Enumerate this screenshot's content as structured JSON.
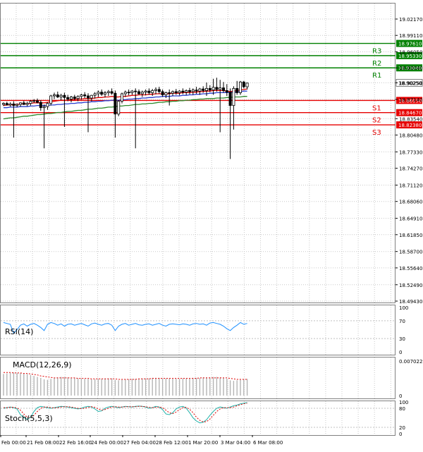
{
  "chart_data": {
    "type": "candlestick",
    "price_axis": {
      "ticks": [
        "19.02170",
        "18.99110",
        "18.96050",
        "18.93040",
        "18.90250",
        "18.87140",
        "18.83540",
        "18.80480",
        "18.77330",
        "18.74270",
        "18.71120",
        "18.68060",
        "18.64910",
        "18.61850",
        "18.58700",
        "18.55640",
        "18.52490",
        "18.49430"
      ],
      "ylim": [
        18.4943,
        19.0217
      ]
    },
    "time_axis": {
      "labels": [
        "Feb 00:00",
        "21 Feb 08:00",
        "22 Feb 16:00",
        "24 Feb 00:00",
        "27 Feb 04:00",
        "28 Feb 12:00",
        "1 Mar 20:00",
        "3 Mar 04:00",
        "6 Mar 08:00"
      ]
    },
    "levels": [
      {
        "name": "R3",
        "value": "18.97610",
        "color": "#008000"
      },
      {
        "name": "R2",
        "value": "18.95330",
        "color": "#008000"
      },
      {
        "name": "R1",
        "value": "18.93040",
        "color": "#008000"
      },
      {
        "name": "S1",
        "value": "18.86950",
        "color": "#e60000"
      },
      {
        "name": "S2",
        "value": "18.84670",
        "color": "#e60000"
      },
      {
        "name": "S3",
        "value": "18.82380",
        "color": "#e60000"
      }
    ],
    "current_price": "18.90250",
    "candles": [
      {
        "o": 18.862,
        "h": 18.866,
        "l": 18.859,
        "c": 18.864
      },
      {
        "o": 18.864,
        "h": 18.867,
        "l": 18.86,
        "c": 18.861
      },
      {
        "o": 18.861,
        "h": 18.866,
        "l": 18.858,
        "c": 18.863
      },
      {
        "o": 18.863,
        "h": 18.868,
        "l": 18.8,
        "c": 18.86
      },
      {
        "o": 18.86,
        "h": 18.864,
        "l": 18.857,
        "c": 18.862
      },
      {
        "o": 18.862,
        "h": 18.866,
        "l": 18.858,
        "c": 18.865
      },
      {
        "o": 18.865,
        "h": 18.869,
        "l": 18.861,
        "c": 18.862
      },
      {
        "o": 18.862,
        "h": 18.867,
        "l": 18.859,
        "c": 18.864
      },
      {
        "o": 18.864,
        "h": 18.87,
        "l": 18.86,
        "c": 18.868
      },
      {
        "o": 18.868,
        "h": 18.872,
        "l": 18.865,
        "c": 18.869
      },
      {
        "o": 18.869,
        "h": 18.873,
        "l": 18.864,
        "c": 18.866
      },
      {
        "o": 18.866,
        "h": 18.87,
        "l": 18.85,
        "c": 18.856
      },
      {
        "o": 18.856,
        "h": 18.862,
        "l": 18.78,
        "c": 18.858
      },
      {
        "o": 18.858,
        "h": 18.866,
        "l": 18.852,
        "c": 18.864
      },
      {
        "o": 18.864,
        "h": 18.88,
        "l": 18.86,
        "c": 18.878
      },
      {
        "o": 18.878,
        "h": 18.884,
        "l": 18.872,
        "c": 18.88
      },
      {
        "o": 18.88,
        "h": 18.886,
        "l": 18.874,
        "c": 18.876
      },
      {
        "o": 18.876,
        "h": 18.882,
        "l": 18.87,
        "c": 18.879
      },
      {
        "o": 18.879,
        "h": 18.884,
        "l": 18.82,
        "c": 18.875
      },
      {
        "o": 18.875,
        "h": 18.88,
        "l": 18.868,
        "c": 18.872
      },
      {
        "o": 18.872,
        "h": 18.878,
        "l": 18.866,
        "c": 18.876
      },
      {
        "o": 18.876,
        "h": 18.88,
        "l": 18.87,
        "c": 18.873
      },
      {
        "o": 18.873,
        "h": 18.879,
        "l": 18.868,
        "c": 18.877
      },
      {
        "o": 18.877,
        "h": 18.882,
        "l": 18.871,
        "c": 18.88
      },
      {
        "o": 18.88,
        "h": 18.885,
        "l": 18.874,
        "c": 18.878
      },
      {
        "o": 18.878,
        "h": 18.883,
        "l": 18.81,
        "c": 18.874
      },
      {
        "o": 18.874,
        "h": 18.88,
        "l": 18.868,
        "c": 18.879
      },
      {
        "o": 18.879,
        "h": 18.885,
        "l": 18.873,
        "c": 18.882
      },
      {
        "o": 18.882,
        "h": 18.888,
        "l": 18.876,
        "c": 18.885
      },
      {
        "o": 18.885,
        "h": 18.89,
        "l": 18.878,
        "c": 18.881
      },
      {
        "o": 18.881,
        "h": 18.887,
        "l": 18.875,
        "c": 18.884
      },
      {
        "o": 18.884,
        "h": 18.889,
        "l": 18.878,
        "c": 18.886
      },
      {
        "o": 18.886,
        "h": 18.892,
        "l": 18.88,
        "c": 18.883
      },
      {
        "o": 18.883,
        "h": 18.888,
        "l": 18.8,
        "c": 18.844
      },
      {
        "o": 18.844,
        "h": 18.87,
        "l": 18.84,
        "c": 18.868
      },
      {
        "o": 18.868,
        "h": 18.884,
        "l": 18.864,
        "c": 18.882
      },
      {
        "o": 18.882,
        "h": 18.888,
        "l": 18.876,
        "c": 18.885
      },
      {
        "o": 18.885,
        "h": 18.89,
        "l": 18.879,
        "c": 18.884
      },
      {
        "o": 18.884,
        "h": 18.889,
        "l": 18.88,
        "c": 18.887
      },
      {
        "o": 18.887,
        "h": 18.892,
        "l": 18.78,
        "c": 18.886
      },
      {
        "o": 18.886,
        "h": 18.89,
        "l": 18.88,
        "c": 18.882
      },
      {
        "o": 18.882,
        "h": 18.888,
        "l": 18.876,
        "c": 18.885
      },
      {
        "o": 18.885,
        "h": 18.89,
        "l": 18.879,
        "c": 18.887
      },
      {
        "o": 18.887,
        "h": 18.892,
        "l": 18.88,
        "c": 18.884
      },
      {
        "o": 18.884,
        "h": 18.891,
        "l": 18.878,
        "c": 18.888
      },
      {
        "o": 18.888,
        "h": 18.894,
        "l": 18.881,
        "c": 18.89
      },
      {
        "o": 18.89,
        "h": 18.895,
        "l": 18.882,
        "c": 18.886
      },
      {
        "o": 18.886,
        "h": 18.89,
        "l": 18.876,
        "c": 18.88
      },
      {
        "o": 18.88,
        "h": 18.886,
        "l": 18.874,
        "c": 18.884
      },
      {
        "o": 18.884,
        "h": 18.89,
        "l": 18.86,
        "c": 18.883
      },
      {
        "o": 18.883,
        "h": 18.888,
        "l": 18.878,
        "c": 18.886
      },
      {
        "o": 18.886,
        "h": 18.891,
        "l": 18.88,
        "c": 18.884
      },
      {
        "o": 18.884,
        "h": 18.889,
        "l": 18.879,
        "c": 18.887
      },
      {
        "o": 18.887,
        "h": 18.892,
        "l": 18.881,
        "c": 18.885
      },
      {
        "o": 18.885,
        "h": 18.89,
        "l": 18.88,
        "c": 18.888
      },
      {
        "o": 18.888,
        "h": 18.893,
        "l": 18.881,
        "c": 18.886
      },
      {
        "o": 18.886,
        "h": 18.892,
        "l": 18.88,
        "c": 18.889
      },
      {
        "o": 18.889,
        "h": 18.895,
        "l": 18.882,
        "c": 18.887
      },
      {
        "o": 18.887,
        "h": 18.893,
        "l": 18.88,
        "c": 18.891
      },
      {
        "o": 18.891,
        "h": 18.896,
        "l": 18.884,
        "c": 18.888
      },
      {
        "o": 18.888,
        "h": 18.903,
        "l": 18.878,
        "c": 18.892
      },
      {
        "o": 18.892,
        "h": 18.898,
        "l": 18.885,
        "c": 18.889
      },
      {
        "o": 18.889,
        "h": 18.91,
        "l": 18.88,
        "c": 18.894
      },
      {
        "o": 18.894,
        "h": 18.912,
        "l": 18.886,
        "c": 18.89
      },
      {
        "o": 18.89,
        "h": 18.908,
        "l": 18.81,
        "c": 18.893
      },
      {
        "o": 18.893,
        "h": 18.904,
        "l": 18.884,
        "c": 18.888
      },
      {
        "o": 18.888,
        "h": 18.9,
        "l": 18.878,
        "c": 18.885
      },
      {
        "o": 18.885,
        "h": 18.892,
        "l": 18.76,
        "c": 18.86
      },
      {
        "o": 18.86,
        "h": 18.896,
        "l": 18.815,
        "c": 18.892
      },
      {
        "o": 18.892,
        "h": 18.906,
        "l": 18.88,
        "c": 18.884
      },
      {
        "o": 18.884,
        "h": 18.906,
        "l": 18.88,
        "c": 18.904
      },
      {
        "o": 18.904,
        "h": 18.906,
        "l": 18.892,
        "c": 18.895
      },
      {
        "o": 18.895,
        "h": 18.903,
        "l": 18.89,
        "c": 18.902
      }
    ],
    "ma_red": [
      18.86,
      18.861,
      18.861,
      18.862,
      18.862,
      18.863,
      18.863,
      18.863,
      18.864,
      18.865,
      18.865,
      18.865,
      18.865,
      18.866,
      18.867,
      18.868,
      18.869,
      18.87,
      18.87,
      18.87,
      18.871,
      18.871,
      18.872,
      18.872,
      18.873,
      18.873,
      18.873,
      18.874,
      18.875,
      18.875,
      18.876,
      18.876,
      18.877,
      18.876,
      18.876,
      18.877,
      18.877,
      18.878,
      18.879,
      18.879,
      18.88,
      18.88,
      18.88,
      18.881,
      18.881,
      18.882,
      18.882,
      18.882,
      18.882,
      18.882,
      18.883,
      18.883,
      18.883,
      18.884,
      18.884,
      18.884,
      18.885,
      18.885,
      18.886,
      18.886,
      18.887,
      18.887,
      18.888,
      18.888,
      18.888,
      18.888,
      18.887,
      18.886,
      18.887,
      18.888,
      18.889,
      18.89,
      18.891
    ],
    "ma_blue": [
      18.856,
      18.856,
      18.857,
      18.857,
      18.857,
      18.858,
      18.858,
      18.858,
      18.859,
      18.859,
      18.86,
      18.86,
      18.86,
      18.86,
      18.861,
      18.861,
      18.862,
      18.862,
      18.863,
      18.863,
      18.864,
      18.864,
      18.865,
      18.865,
      18.866,
      18.866,
      18.867,
      18.867,
      18.868,
      18.868,
      18.869,
      18.869,
      18.87,
      18.87,
      18.87,
      18.871,
      18.871,
      18.872,
      18.872,
      18.873,
      18.873,
      18.874,
      18.874,
      18.875,
      18.875,
      18.876,
      18.876,
      18.877,
      18.877,
      18.877,
      18.878,
      18.878,
      18.878,
      18.879,
      18.879,
      18.88,
      18.88,
      18.881,
      18.881,
      18.882,
      18.882,
      18.883,
      18.883,
      18.884,
      18.884,
      18.884,
      18.884,
      18.884,
      18.885,
      18.885,
      18.886,
      18.887,
      18.887
    ],
    "ma_green": [
      18.835,
      18.836,
      18.837,
      18.837,
      18.838,
      18.839,
      18.84,
      18.84,
      18.841,
      18.842,
      18.843,
      18.843,
      18.844,
      18.845,
      18.845,
      18.846,
      18.847,
      18.847,
      18.848,
      18.849,
      18.849,
      18.85,
      18.851,
      18.851,
      18.852,
      18.853,
      18.853,
      18.854,
      18.855,
      18.855,
      18.856,
      18.857,
      18.857,
      18.858,
      18.859,
      18.859,
      18.86,
      18.86,
      18.861,
      18.862,
      18.862,
      18.863,
      18.863,
      18.864,
      18.864,
      18.865,
      18.866,
      18.866,
      18.867,
      18.867,
      18.868,
      18.868,
      18.869,
      18.869,
      18.87,
      18.87,
      18.871,
      18.871,
      18.872,
      18.872,
      18.873,
      18.873,
      18.873,
      18.874,
      18.874,
      18.874,
      18.875,
      18.875,
      18.876,
      18.876,
      18.876,
      18.877,
      18.877
    ],
    "rsi": {
      "label": "RSI(14)",
      "ticks": [
        "100",
        "70",
        "30",
        "0"
      ],
      "ylim": [
        0,
        100
      ],
      "values": [
        66,
        64,
        62,
        42,
        50,
        60,
        63,
        58,
        62,
        64,
        60,
        55,
        48,
        62,
        66,
        64,
        60,
        63,
        58,
        62,
        63,
        60,
        62,
        64,
        61,
        58,
        63,
        65,
        62,
        60,
        63,
        64,
        60,
        48,
        58,
        62,
        64,
        60,
        62,
        64,
        61,
        60,
        62,
        63,
        60,
        62,
        64,
        60,
        58,
        62,
        63,
        62,
        61,
        63,
        62,
        60,
        63,
        64,
        62,
        63,
        60,
        65,
        66,
        64,
        62,
        58,
        52,
        48,
        55,
        60,
        66,
        62,
        64
      ]
    },
    "macd": {
      "label": "MACD(12,26,9)",
      "ticks": [
        "0.007022",
        "0"
      ],
      "ylim": [
        0,
        0.007022
      ],
      "histogram": [
        0.0044,
        0.0045,
        0.0046,
        0.0047,
        0.0046,
        0.0046,
        0.0045,
        0.0044,
        0.0042,
        0.004,
        0.0038,
        0.0036,
        0.0033,
        0.0032,
        0.0034,
        0.0036,
        0.0037,
        0.0038,
        0.0038,
        0.0037,
        0.0036,
        0.0036,
        0.0035,
        0.0035,
        0.0034,
        0.0034,
        0.0033,
        0.0033,
        0.0034,
        0.0034,
        0.0035,
        0.0035,
        0.0035,
        0.0032,
        0.0031,
        0.0032,
        0.0033,
        0.0033,
        0.0034,
        0.0034,
        0.0034,
        0.0035,
        0.0035,
        0.0035,
        0.0036,
        0.0036,
        0.0036,
        0.0035,
        0.0035,
        0.0035,
        0.0034,
        0.0034,
        0.0034,
        0.0035,
        0.0035,
        0.0035,
        0.0036,
        0.0036,
        0.0036,
        0.0037,
        0.0037,
        0.0037,
        0.0038,
        0.0038,
        0.0037,
        0.0036,
        0.0034,
        0.0031,
        0.003,
        0.0031,
        0.0032,
        0.0033,
        0.0034
      ],
      "signal": [
        0.0047,
        0.0047,
        0.0047,
        0.0046,
        0.0046,
        0.0046,
        0.0045,
        0.0045,
        0.0044,
        0.0043,
        0.0042,
        0.004,
        0.0039,
        0.0038,
        0.0037,
        0.0036,
        0.0036,
        0.0036,
        0.0036,
        0.0036,
        0.0036,
        0.0036,
        0.0035,
        0.0035,
        0.0035,
        0.0035,
        0.0034,
        0.0034,
        0.0034,
        0.0034,
        0.0034,
        0.0034,
        0.0034,
        0.0034,
        0.0033,
        0.0033,
        0.0033,
        0.0033,
        0.0033,
        0.0033,
        0.0034,
        0.0034,
        0.0034,
        0.0034,
        0.0035,
        0.0035,
        0.0035,
        0.0035,
        0.0035,
        0.0035,
        0.0035,
        0.0035,
        0.0035,
        0.0035,
        0.0035,
        0.0035,
        0.0035,
        0.0035,
        0.0036,
        0.0036,
        0.0036,
        0.0036,
        0.0036,
        0.0036,
        0.0036,
        0.0036,
        0.0036,
        0.0035,
        0.0034,
        0.0033,
        0.0033,
        0.0033,
        0.0033
      ]
    },
    "stoch": {
      "label": "Stoch(5,5,3)",
      "ticks": [
        "100",
        "80",
        "20",
        "0"
      ],
      "ylim": [
        0,
        100
      ],
      "main": [
        80,
        82,
        84,
        82,
        78,
        60,
        50,
        45,
        52,
        70,
        82,
        86,
        84,
        82,
        80,
        82,
        84,
        86,
        85,
        84,
        82,
        80,
        78,
        80,
        84,
        86,
        84,
        78,
        70,
        72,
        80,
        84,
        86,
        84,
        82,
        84,
        86,
        85,
        84,
        86,
        87,
        86,
        84,
        80,
        82,
        86,
        84,
        76,
        62,
        60,
        66,
        78,
        84,
        86,
        80,
        66,
        50,
        40,
        34,
        36,
        44,
        58,
        70,
        80,
        84,
        82,
        80,
        84,
        88,
        90,
        94,
        96,
        98
      ],
      "signal": [
        82,
        82,
        83,
        83,
        81,
        74,
        62,
        52,
        50,
        58,
        70,
        80,
        84,
        84,
        82,
        81,
        82,
        84,
        85,
        85,
        84,
        82,
        80,
        79,
        80,
        83,
        85,
        83,
        78,
        74,
        76,
        80,
        84,
        85,
        84,
        84,
        85,
        85,
        85,
        85,
        86,
        86,
        85,
        83,
        82,
        83,
        84,
        82,
        74,
        66,
        63,
        68,
        76,
        82,
        83,
        77,
        66,
        52,
        42,
        37,
        38,
        46,
        58,
        70,
        78,
        82,
        82,
        82,
        84,
        88,
        91,
        94,
        96
      ]
    }
  }
}
